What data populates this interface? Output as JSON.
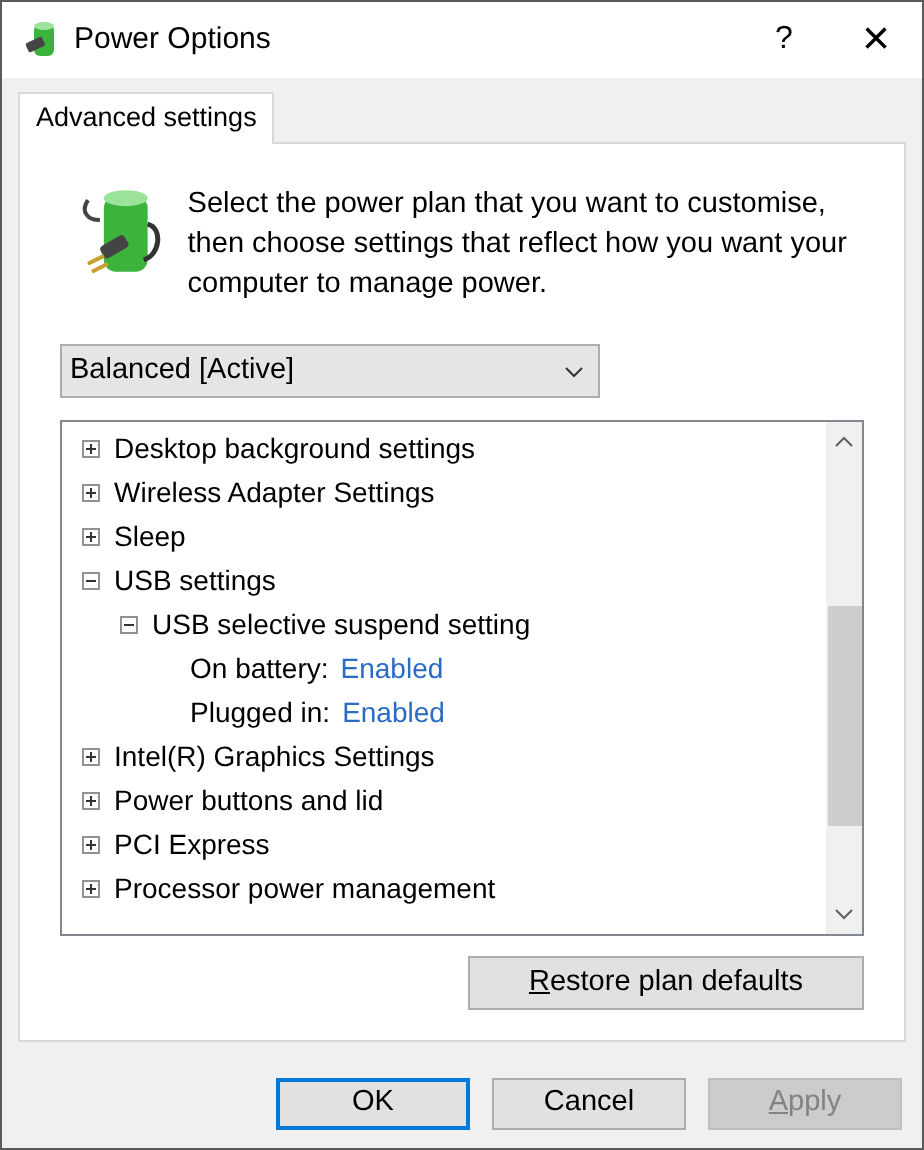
{
  "window": {
    "title": "Power Options",
    "help_button": "?",
    "close_button": "×"
  },
  "tabs": [
    {
      "label": "Advanced settings",
      "selected": true
    }
  ],
  "description": "Select the power plan that you want to customise, then choose settings that reflect how you want your computer to manage power.",
  "plan_dropdown": {
    "value": "Balanced [Active]"
  },
  "settings_tree": [
    {
      "label": "Desktop background settings",
      "expanded": false
    },
    {
      "label": "Wireless Adapter Settings",
      "expanded": false
    },
    {
      "label": "Sleep",
      "expanded": false
    },
    {
      "label": "USB settings",
      "expanded": true,
      "children": [
        {
          "label": "USB selective suspend setting",
          "expanded": true,
          "children": [
            {
              "label": "On battery:",
              "value": "Enabled"
            },
            {
              "label": "Plugged in:",
              "value": "Enabled"
            }
          ]
        }
      ]
    },
    {
      "label": "Intel(R) Graphics Settings",
      "expanded": false
    },
    {
      "label": "Power buttons and lid",
      "expanded": false
    },
    {
      "label": "PCI Express",
      "expanded": false
    },
    {
      "label": "Processor power management",
      "expanded": false
    }
  ],
  "restore_button": {
    "label": "Restore plan defaults",
    "mnemonic": true
  },
  "buttons": [
    {
      "label": "OK",
      "default": true,
      "disabled": false,
      "mnemonic": false
    },
    {
      "label": "Cancel",
      "default": false,
      "disabled": false,
      "mnemonic": false
    },
    {
      "label": "Apply",
      "default": false,
      "disabled": true,
      "mnemonic": true
    }
  ]
}
